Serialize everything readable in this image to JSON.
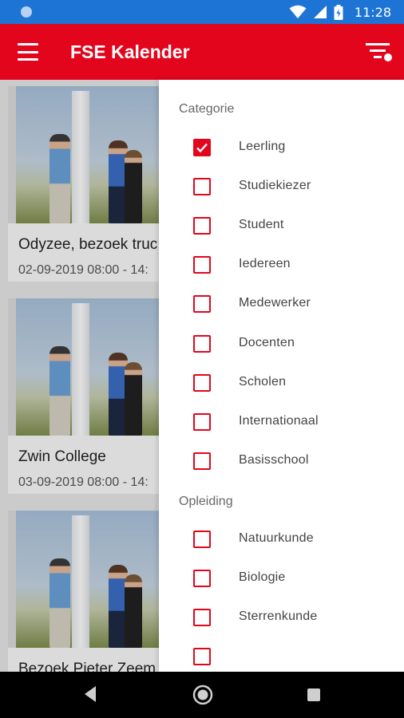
{
  "status_bar": {
    "time": "11:28",
    "icons": [
      "notification-dot",
      "wifi-icon",
      "signal-icon",
      "battery-icon"
    ]
  },
  "app_bar": {
    "title": "FSE Kalender",
    "menu_icon": "hamburger-menu-icon",
    "filter_icon": "filter-list-icon",
    "color": "#e2051c"
  },
  "feed": {
    "cards": [
      {
        "title": "Odyzee, bezoek truc",
        "date": "02-09-2019 08:00 - 14:"
      },
      {
        "title": "Zwin College",
        "date": "03-09-2019 08:00 - 14:"
      },
      {
        "title": "Bezoek Pieter Zeem",
        "date": ""
      }
    ]
  },
  "drawer": {
    "sections": [
      {
        "label": "Categorie",
        "items": [
          {
            "label": "Leerling",
            "checked": true
          },
          {
            "label": "Studiekiezer",
            "checked": false
          },
          {
            "label": "Student",
            "checked": false
          },
          {
            "label": "Iedereen",
            "checked": false
          },
          {
            "label": "Medewerker",
            "checked": false
          },
          {
            "label": "Docenten",
            "checked": false
          },
          {
            "label": "Scholen",
            "checked": false
          },
          {
            "label": "Internationaal",
            "checked": false
          },
          {
            "label": "Basisschool",
            "checked": false
          }
        ]
      },
      {
        "label": "Opleiding",
        "items": [
          {
            "label": "Natuurkunde",
            "checked": false
          },
          {
            "label": "Biologie",
            "checked": false
          },
          {
            "label": "Sterrenkunde",
            "checked": false
          },
          {
            "label": "",
            "checked": false
          }
        ]
      }
    ],
    "accent_color": "#e2051c"
  },
  "nav_bar": {
    "icons": [
      "back-icon",
      "home-icon",
      "recent-apps-icon"
    ]
  }
}
